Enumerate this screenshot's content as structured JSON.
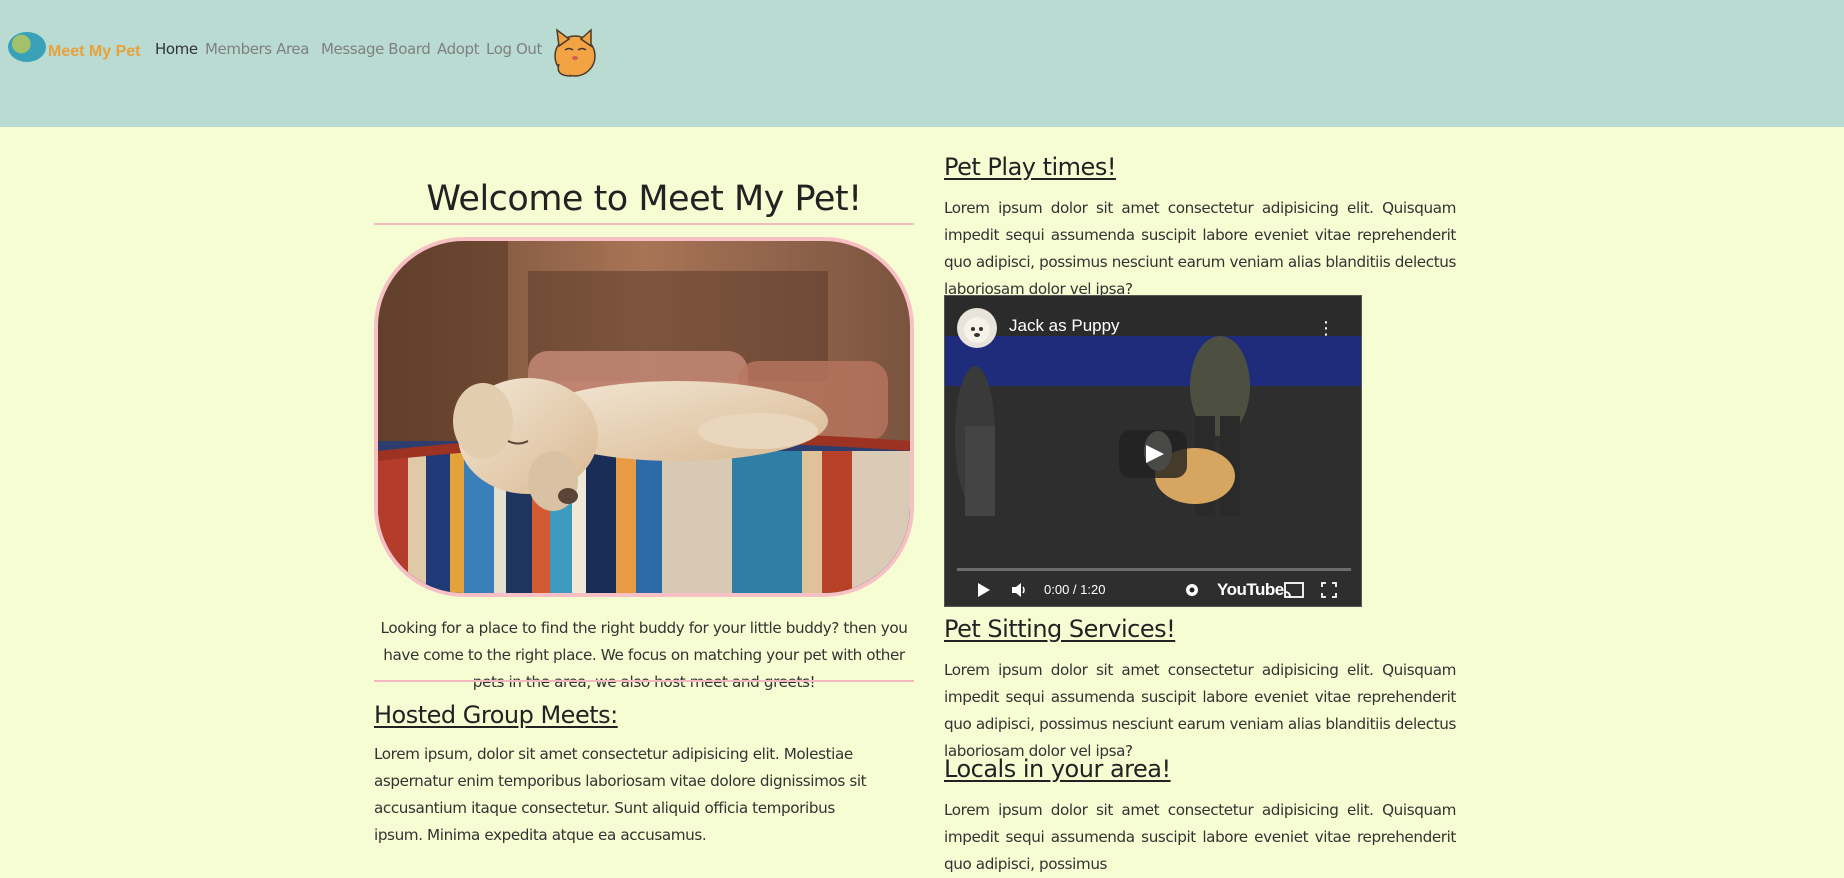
{
  "nav": {
    "logo_text": "Meet My Pet",
    "links": [
      "Home",
      "Members Area",
      "Message Board",
      "Adopt",
      "Log Out"
    ],
    "active": "Home"
  },
  "main": {
    "welcome": "Welcome to Meet My Pet!",
    "photo_alt": "Golden retriever sleeping on a striped blanket",
    "intro": "Looking for a place to find the right buddy for your little buddy? then you have come to the right place. We focus on matching your pet with other pets in the area, we also host meet and greets!",
    "hosted_title": "Hosted Group Meets:",
    "hosted_text": "Lorem ipsum, dolor sit amet consectetur adipisicing elit. Molestiae aspernatur enim temporibus laboriosam vitae dolore dignissimos sit accusantium itaque consectetur. Sunt aliquid officia temporibus ipsum. Minima expedita atque ea accusamus."
  },
  "sidebar": {
    "play_title": "Pet Play times!",
    "play_text": "Lorem ipsum dolor sit amet consectetur adipisicing elit. Quisquam impedit sequi assumenda suscipit labore eveniet vitae reprehenderit quo adipisci, possimus nesciunt earum veniam alias blanditiis delectus laboriosam dolor vel ipsa?",
    "sitting_title": "Pet Sitting Services!",
    "sitting_text": "Lorem ipsum dolor sit amet consectetur adipisicing elit. Quisquam impedit sequi assumenda suscipit labore eveniet vitae reprehenderit quo adipisci, possimus nesciunt earum veniam alias blanditiis delectus laboriosam dolor vel ipsa?",
    "locals_title": "Locals in your area!",
    "locals_text": "Lorem ipsum dolor sit amet consectetur adipisicing elit. Quisquam impedit sequi assumenda suscipit labore eveniet vitae reprehenderit quo adipisci, possimus"
  },
  "video": {
    "title": "Jack as Puppy",
    "time": "0:00 / 1:20",
    "brand": "YouTube",
    "progress": 0
  },
  "colors": {
    "page_bg": "#f7fdd3",
    "nav_bg": "#b9dbd2",
    "accent_pink": "#f4b9bf",
    "logo_orange": "#e9a13b"
  },
  "icons": [
    "globe-logo-icon",
    "cat-logo-icon",
    "play-icon",
    "volume-icon",
    "settings-icon",
    "cast-icon",
    "fullscreen-icon",
    "more-icon"
  ]
}
